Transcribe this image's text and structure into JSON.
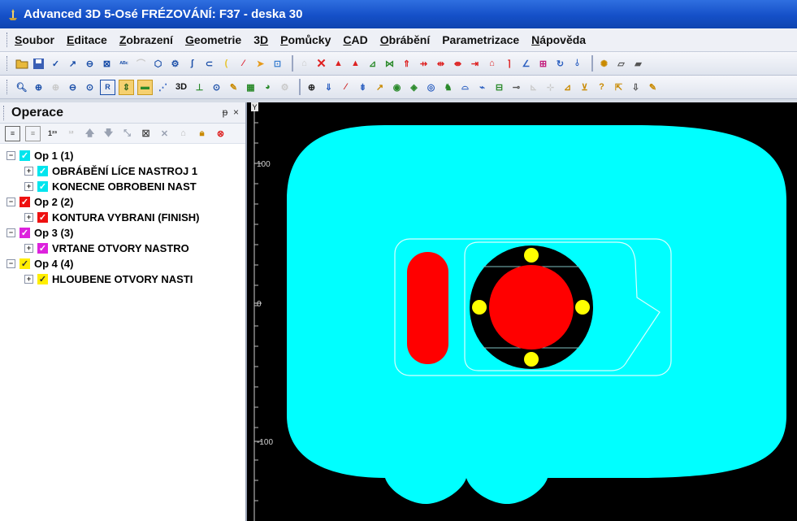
{
  "title": "Advanced 3D 5-Osé FRÉZOVÁNÍ: F37 - deska 30",
  "menu": [
    {
      "u": "S",
      "rest": "oubor"
    },
    {
      "u": "E",
      "rest": "ditace"
    },
    {
      "u": "Z",
      "rest": "obrazení"
    },
    {
      "u": "G",
      "rest": "eometrie"
    },
    {
      "u": "",
      "rest": "3"
    },
    {
      "u": "P",
      "rest": "omůcky"
    },
    {
      "u": "C",
      "rest": "AD"
    },
    {
      "u": "O",
      "rest": "brábění"
    },
    {
      "u": "",
      "rest": "Parametrizace"
    },
    {
      "u": "N",
      "rest": "ápověda"
    }
  ],
  "menu_3d": {
    "prefix": "3",
    "u": "D"
  },
  "toolbar2_label_3d": "3D",
  "panel": {
    "title": "Operace",
    "buttons": "ᵽ ×",
    "tree": [
      {
        "label": "Op 1  (1)",
        "color": "#00e5ee",
        "level": 0
      },
      {
        "label": "OBRÁBĚNÍ LÍCE  NASTROJ 1",
        "color": "#00e5ee",
        "level": 1
      },
      {
        "label": "KONECNE OBROBENI  NAST",
        "color": "#00e5ee",
        "level": 1
      },
      {
        "label": "Op 2  (2)",
        "color": "#ee1111",
        "level": 0
      },
      {
        "label": "KONTURA VYBRANI (FINISH)",
        "color": "#ee1111",
        "level": 1
      },
      {
        "label": "Op 3  (3)",
        "color": "#dd22dd",
        "level": 0
      },
      {
        "label": "VRTANE OTVORY  NASTRO",
        "color": "#dd22dd",
        "level": 1
      },
      {
        "label": "Op 4  (4)",
        "color": "#ffee00",
        "level": 0
      },
      {
        "label": "HLOUBENE OTVORY  NASTI",
        "color": "#ffee00",
        "level": 1
      }
    ]
  },
  "viewport": {
    "ruler_y_letter": "Y",
    "ticks": [
      "100",
      "0",
      "-100"
    ]
  },
  "colors": {
    "stock": "#00ffff",
    "pocket": "#ff0000",
    "holes": "#ffff00",
    "background": "#000000"
  }
}
